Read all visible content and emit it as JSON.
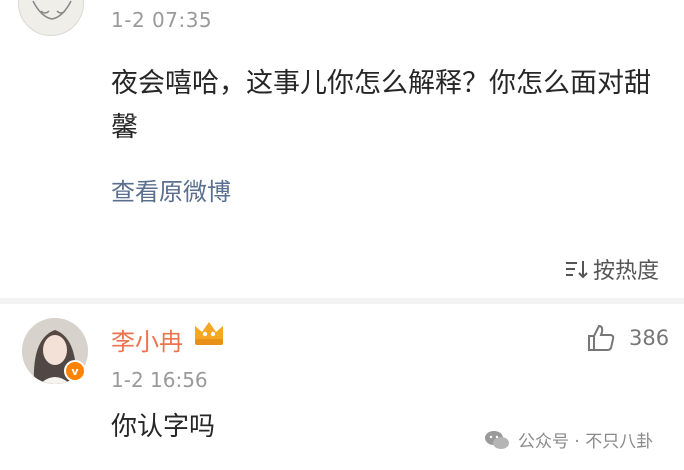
{
  "post": {
    "time": "1-2 07:35",
    "text": "夜会嘻哈，这事儿你怎么解释？你怎么面对甜馨",
    "view_link": "查看原微博",
    "sort_label": "按热度"
  },
  "comment": {
    "user_name": "李小冉",
    "time": "1-2 16:56",
    "text": "你认字吗",
    "like_count": "386",
    "verified_mark": "v"
  },
  "watermark": {
    "text": "公众号 · 不只八卦"
  },
  "colors": {
    "name_color": "#eb7350",
    "link_color": "#5a6f8f",
    "badge_color": "#ff8200",
    "vip_color": "#f5a623"
  }
}
